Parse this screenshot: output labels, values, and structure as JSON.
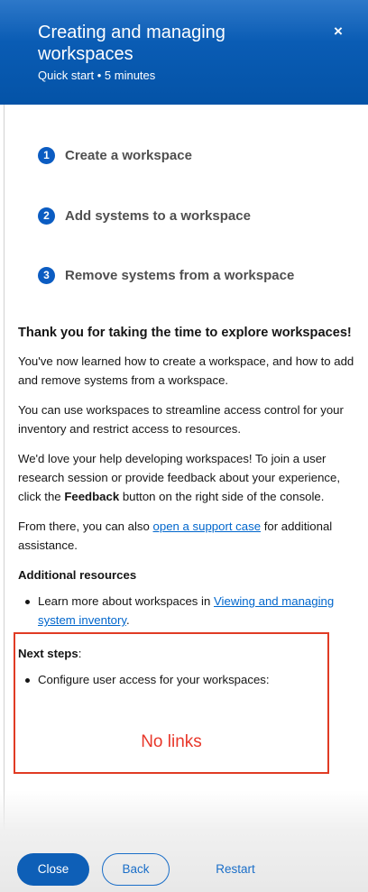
{
  "header": {
    "title": "Creating and managing workspaces",
    "subtitle": "Quick start • 5 minutes",
    "close_label": "×"
  },
  "steps": [
    {
      "number": "1",
      "label": "Create a workspace"
    },
    {
      "number": "2",
      "label": "Add systems to a workspace"
    },
    {
      "number": "3",
      "label": "Remove systems from a workspace"
    }
  ],
  "content": {
    "heading": "Thank you for taking the time to explore workspaces!",
    "para1": "You've now learned how to create a workspace, and how to add and remove systems from a workspace.",
    "para2": "You can use workspaces to streamline access control for your inventory and restrict access to resources.",
    "para3_before": "We'd love your help developing workspaces! To join a user research session or provide feedback about your experience, click the ",
    "para3_bold": "Feedback",
    "para3_after": " button on the right side of the console.",
    "para4_before": "From there, you can also ",
    "para4_link": "open a support case",
    "para4_after": " for additional assistance.",
    "additional_heading": "Additional resources",
    "resource_before": "Learn more about workspaces in ",
    "resource_link": "Viewing and managing system inventory",
    "resource_after": "."
  },
  "next_steps": {
    "heading": "Next steps",
    "colon": ":",
    "item": "Configure user access for your workspaces:"
  },
  "annotation": {
    "text": "No links",
    "color": "#e03b24"
  },
  "footer": {
    "close_label": "Close",
    "back_label": "Back",
    "restart_label": "Restart"
  },
  "colors": {
    "header_bg": "#0453a7",
    "step_badge": "#0b5cc2",
    "link": "#0066cc",
    "primary_button": "#0e5fb7"
  }
}
